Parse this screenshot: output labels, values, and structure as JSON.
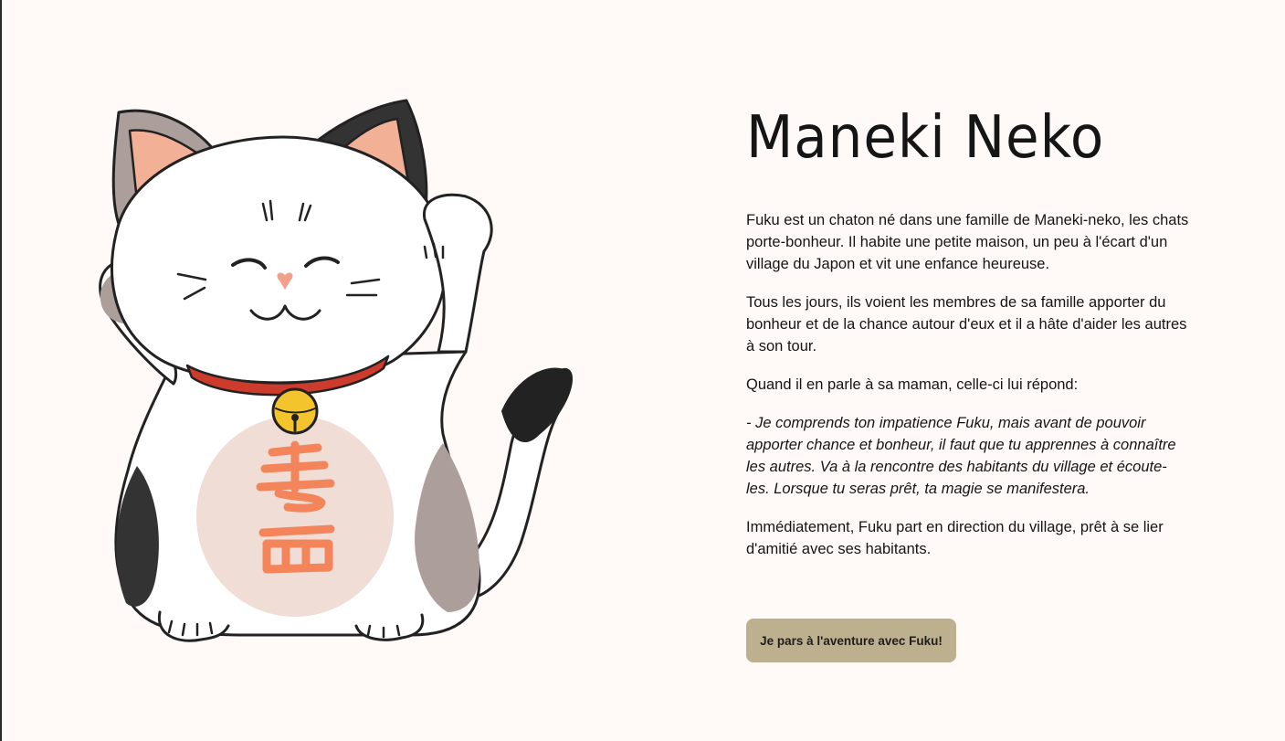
{
  "colors": {
    "background": "#fffaf8",
    "button": "#bdb08f",
    "collar": "#cc3b2c",
    "bell": "#f4c42c",
    "belly": "#efddd6",
    "kanji": "#f4855a",
    "grey_patch": "#ac9f9b",
    "black_patch": "#333333"
  },
  "illustration": {
    "subject": "maneki-neko-cat",
    "belly_kanji": "寿西"
  },
  "header": {
    "title": "Maneki Neko"
  },
  "story": {
    "p1": "Fuku est un chaton né dans une famille de Maneki-neko, les chats porte-bonheur. Il habite une petite maison, un peu à l'écart d'un village du Japon et vit une enfance heureuse.",
    "p2": "Tous les jours, ils voient les membres de sa famille apporter du bonheur et de la chance autour d'eux et il a hâte d'aider les autres à son tour.",
    "p3": "Quand il en parle à sa maman, celle-ci lui répond:",
    "quote": "- Je comprends ton impatience Fuku, mais avant de pouvoir apporter chance et bonheur, il faut que tu apprennes à connaître les autres. Va à la rencontre des habitants du village et écoute-les. Lorsque tu seras prêt, ta magie se manifestera.",
    "p4": "Immédiatement, Fuku part en direction du village, prêt à se lier d'amitié avec ses habitants."
  },
  "cta": {
    "label": "Je pars à l'aventure avec Fuku!"
  }
}
